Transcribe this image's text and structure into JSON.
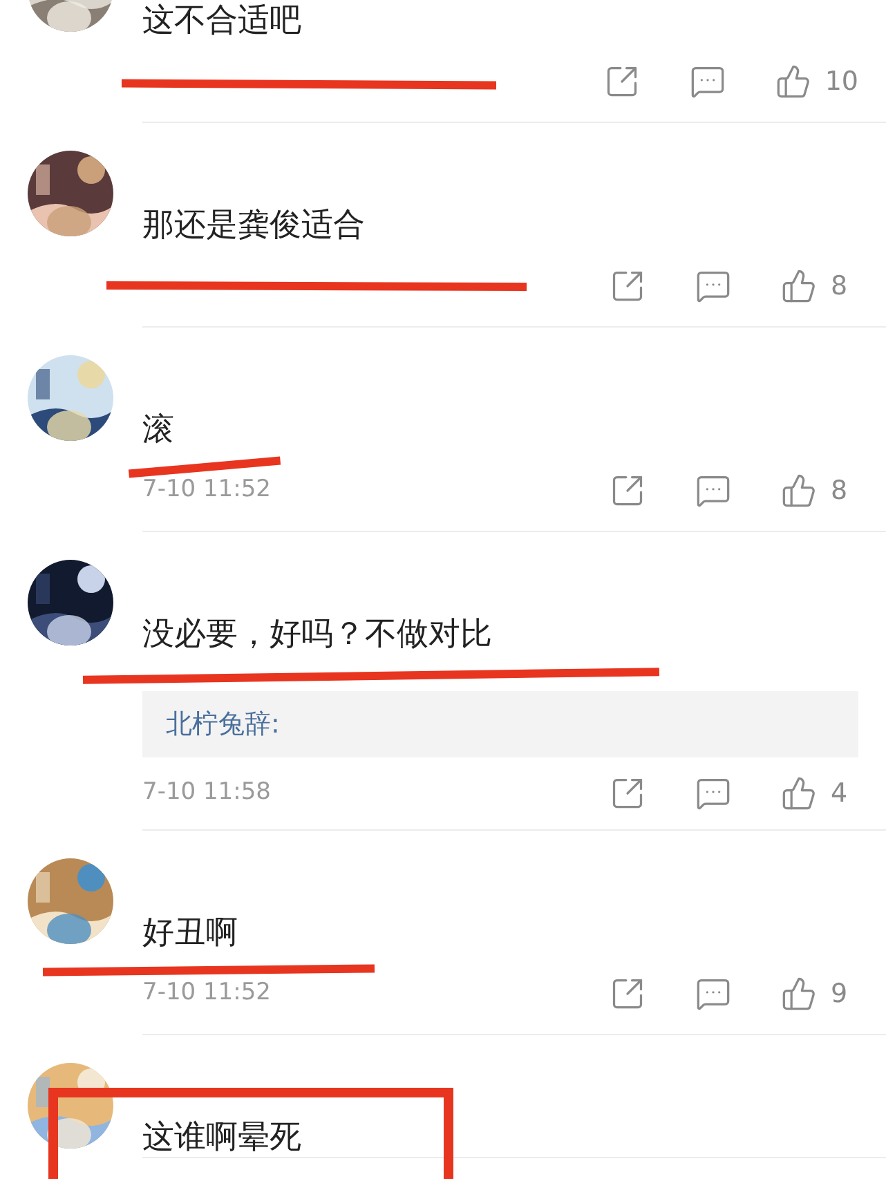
{
  "comments": [
    {
      "text": "这不合适吧",
      "likes": "10",
      "kind": "strike"
    },
    {
      "text": "那还是龚俊适合",
      "likes": "8",
      "kind": "strike"
    },
    {
      "text": "滚",
      "time": "7-10 11:52",
      "likes": "8",
      "kind": "underline"
    },
    {
      "text": "没必要，好吗？不做对比",
      "quote": "北柠兔辞:",
      "time": "7-10 11:58",
      "likes": "4",
      "kind": "underline"
    },
    {
      "text": "好丑啊",
      "time": "7-10 11:52",
      "likes": "9",
      "kind": "underline"
    },
    {
      "text": "这谁啊晕死",
      "kind": "box"
    }
  ]
}
